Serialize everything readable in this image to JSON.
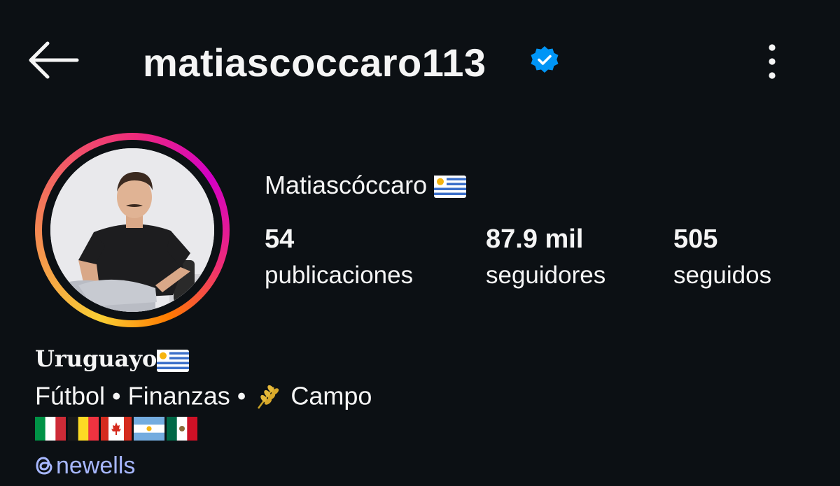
{
  "header": {
    "username": "matiascoccaro113",
    "back_icon": "arrow-left-icon",
    "verified_icon": "verified-badge-icon",
    "more_icon": "more-vertical-icon"
  },
  "profile": {
    "display_name": "Matiascóccaro",
    "display_name_flag": "uruguay-flag-icon",
    "avatar": "profile-avatar-photo",
    "stats": [
      {
        "value": "54",
        "label": "publicaciones"
      },
      {
        "value": "87.9 mil",
        "label": "seguidores"
      },
      {
        "value": "505",
        "label": "seguidos"
      }
    ]
  },
  "bio": {
    "title": "Uruguayo",
    "title_flag": "uruguay-flag-icon",
    "line_part1": "Fútbol • Finanzas •",
    "line_icon": "wheat-icon",
    "line_part2": "Campo",
    "flags": [
      "italy-flag-icon",
      "belgium-flag-icon",
      "canada-flag-icon",
      "argentina-flag-icon",
      "mexico-flag-icon"
    ],
    "link_icon": "threads-icon",
    "link_text": "newells"
  },
  "colors": {
    "background": "#0c1014",
    "text": "#f5f5f5",
    "link": "#a7b7ff",
    "verified": "#0095f6"
  }
}
